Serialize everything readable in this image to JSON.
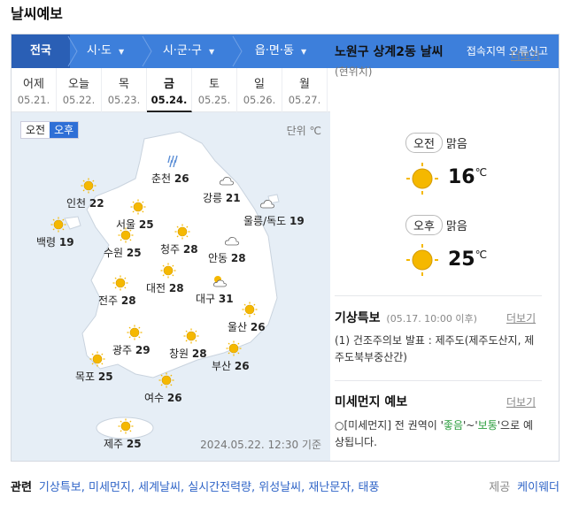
{
  "title": "날씨예보",
  "region_bar": {
    "items": [
      "전국",
      "시·도",
      "시·군·구",
      "읍·면·동"
    ],
    "report": "접속지역 오류신고"
  },
  "days": [
    {
      "name": "어제",
      "date": "05.21."
    },
    {
      "name": "오늘",
      "date": "05.22."
    },
    {
      "name": "목",
      "date": "05.23."
    },
    {
      "name": "금",
      "date": "05.24."
    },
    {
      "name": "토",
      "date": "05.25."
    },
    {
      "name": "일",
      "date": "05.26."
    },
    {
      "name": "월",
      "date": "05.27."
    }
  ],
  "map": {
    "am_label": "오전",
    "pm_label": "오후",
    "unit": "단위 ℃",
    "timestamp": "2024.05.22. 12:30 기준",
    "cities": [
      {
        "name": "춘천",
        "temp": "26",
        "icon": "rain-icon"
      },
      {
        "name": "강릉",
        "temp": "21",
        "icon": "cloud-icon"
      },
      {
        "name": "인천",
        "temp": "22",
        "icon": "sun-icon"
      },
      {
        "name": "서울",
        "temp": "25",
        "icon": "sun-icon"
      },
      {
        "name": "울릉/독도",
        "temp": "19",
        "icon": "cloud-icon"
      },
      {
        "name": "백령",
        "temp": "19",
        "icon": "sun-icon"
      },
      {
        "name": "수원",
        "temp": "25",
        "icon": "sun-icon"
      },
      {
        "name": "청주",
        "temp": "28",
        "icon": "sun-icon"
      },
      {
        "name": "안동",
        "temp": "28",
        "icon": "cloud-icon"
      },
      {
        "name": "대전",
        "temp": "28",
        "icon": "sun-icon"
      },
      {
        "name": "대구",
        "temp": "31",
        "icon": "partly-cloudy-icon"
      },
      {
        "name": "전주",
        "temp": "28",
        "icon": "sun-icon"
      },
      {
        "name": "울산",
        "temp": "26",
        "icon": "sun-icon"
      },
      {
        "name": "광주",
        "temp": "29",
        "icon": "sun-icon"
      },
      {
        "name": "창원",
        "temp": "28",
        "icon": "sun-icon"
      },
      {
        "name": "부산",
        "temp": "26",
        "icon": "sun-icon"
      },
      {
        "name": "목포",
        "temp": "25",
        "icon": "sun-icon"
      },
      {
        "name": "여수",
        "temp": "26",
        "icon": "sun-icon"
      },
      {
        "name": "제주",
        "temp": "25",
        "icon": "sun-icon"
      }
    ]
  },
  "location": {
    "title": "노원구 상계2동 날씨",
    "sub": "(현위치)",
    "more": "더보기",
    "am": {
      "label": "오전",
      "cond": "맑음",
      "temp": "16"
    },
    "pm": {
      "label": "오후",
      "cond": "맑음",
      "temp": "25"
    },
    "unit": "℃"
  },
  "special": {
    "title": "기상특보",
    "meta": "(05.17. 10:00 이후)",
    "more": "더보기",
    "text": "(1) 건조주의보 발표 : 제주도(제주도산지, 제주도북부중산간)"
  },
  "dust": {
    "title": "미세먼지 예보",
    "more": "더보기",
    "p1": "○[미세먼지] 전 권역이 '",
    "good": "좋음",
    "p2": "'~'",
    "normal": "보통",
    "p3": "'으로 예상됩니다."
  },
  "related": {
    "label": "관련",
    "links": [
      "기상특보",
      "미세먼지",
      "세계날씨",
      "실시간전력량",
      "위성날씨",
      "재난문자",
      "태풍"
    ]
  },
  "provider": {
    "label": "제공",
    "name": "케이웨더"
  },
  "colors": {
    "accent": "#3d7fdb",
    "accent_dark": "#2a5fb5",
    "sun": "#f5b800",
    "link": "#2f64c7"
  }
}
